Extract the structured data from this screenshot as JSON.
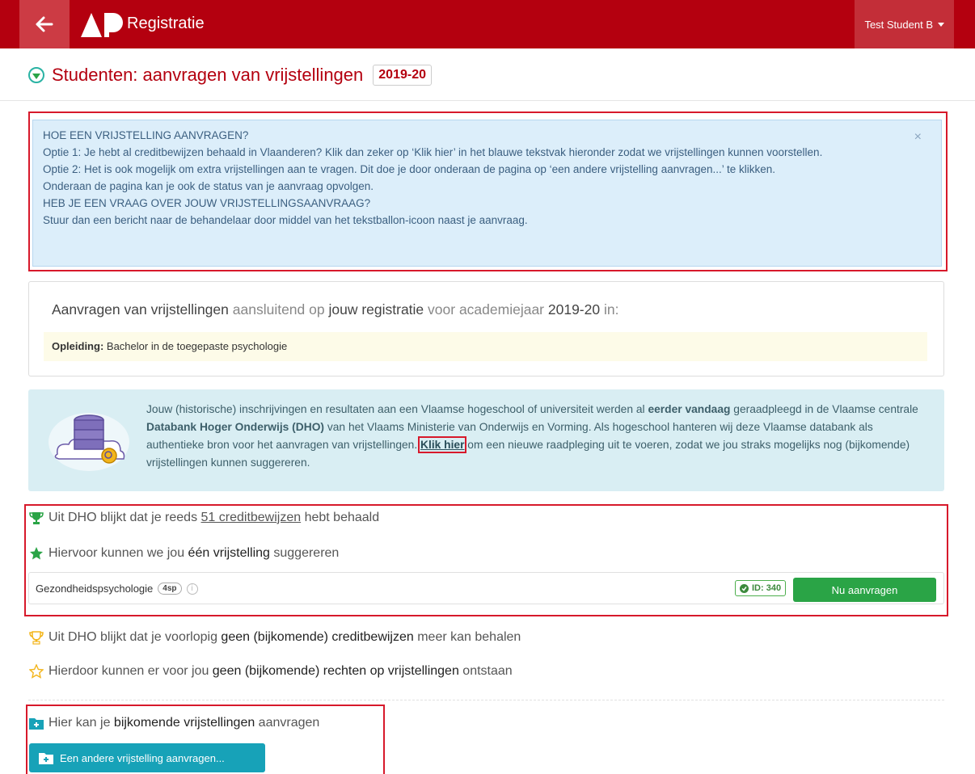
{
  "nav": {
    "title": "Registratie",
    "user": "Test Student B"
  },
  "page": {
    "title": "Studenten: aanvragen van vrijstellingen",
    "year": "2019-20"
  },
  "alert": {
    "lines": [
      "HOE EEN VRIJSTELLING AANVRAGEN?",
      "Optie 1: Je hebt al creditbewijzen behaald in Vlaanderen? Klik dan zeker op ‘Klik hier’ in het blauwe tekstvak hieronder zodat we vrijstellingen kunnen voorstellen.",
      "Optie 2: Het is ook mogelijk om extra vrijstellingen aan te vragen. Dit doe je door onderaan de pagina op ‘een andere vrijstelling aanvragen...’ te klikken.",
      "Onderaan de pagina kan je ook de status van je aanvraag opvolgen.",
      "HEB JE EEN VRAAG OVER JOUW VRIJSTELLINGSAANVRAAG?",
      "Stuur dan een bericht naar de behandelaar door middel van het tekstballon-icoon naast je aanvraag."
    ],
    "close": "×"
  },
  "registration": {
    "h1": "Aanvragen van vrijstellingen",
    "h2": " aansluitend op ",
    "h3": "jouw registratie",
    "h4": " voor academiejaar ",
    "h5": "2019-20",
    "h6": " in:",
    "opleiding_label": "Opleiding:",
    "opleiding_value": " Bachelor in de toegepaste psychologie"
  },
  "dho": {
    "t1": "Jouw (historische) inschrijvingen en resultaten aan een Vlaamse hogeschool of universiteit werden al ",
    "t2": "eerder vandaag",
    "t3": " geraadpleegd in de Vlaamse centrale ",
    "t4": "Databank Hoger Onderwijs (DHO)",
    "t5": " van het Vlaams Ministerie van Onderwijs en Vorming. Als hogeschool hanteren wij deze Vlaamse databank als authentieke bron voor het aanvragen van vrijstellingen. ",
    "link": "Klik hier",
    "t6": " om een nieuwe raadpleging uit te voeren, zodat we jou straks mogelijks nog (bijkomende) vrijstellingen kunnen suggereren."
  },
  "suggest": {
    "credits": {
      "a": "Uit DHO blijkt dat je reeds ",
      "b": "51 creditbewijzen",
      "c": " hebt behaald"
    },
    "exempt": {
      "a": "Hiervoor kunnen we jou ",
      "b": "één vrijstelling",
      "c": " suggereren"
    },
    "course": {
      "name": "Gezondheidspsychologie",
      "sp": "4sp",
      "id": "ID: 340",
      "button": "Nu aanvragen"
    }
  },
  "future": {
    "l1": {
      "a": "Uit DHO blijkt dat je voorlopig ",
      "b": "geen (bijkomende) creditbewijzen",
      "c": " meer kan behalen"
    },
    "l2": {
      "a": "Hierdoor kunnen er voor jou ",
      "b": "geen (bijkomende) rechten op vrijstellingen",
      "c": " ontstaan"
    }
  },
  "other": {
    "a": "Hier kan je ",
    "b": "bijkomende vrijstellingen",
    "c": " aanvragen",
    "button": "Een andere vrijstelling aanvragen..."
  },
  "colors": {
    "brand": "#b4000f",
    "success": "#2aa446",
    "info": "#17a2b8",
    "highlight": "#d7192b"
  }
}
